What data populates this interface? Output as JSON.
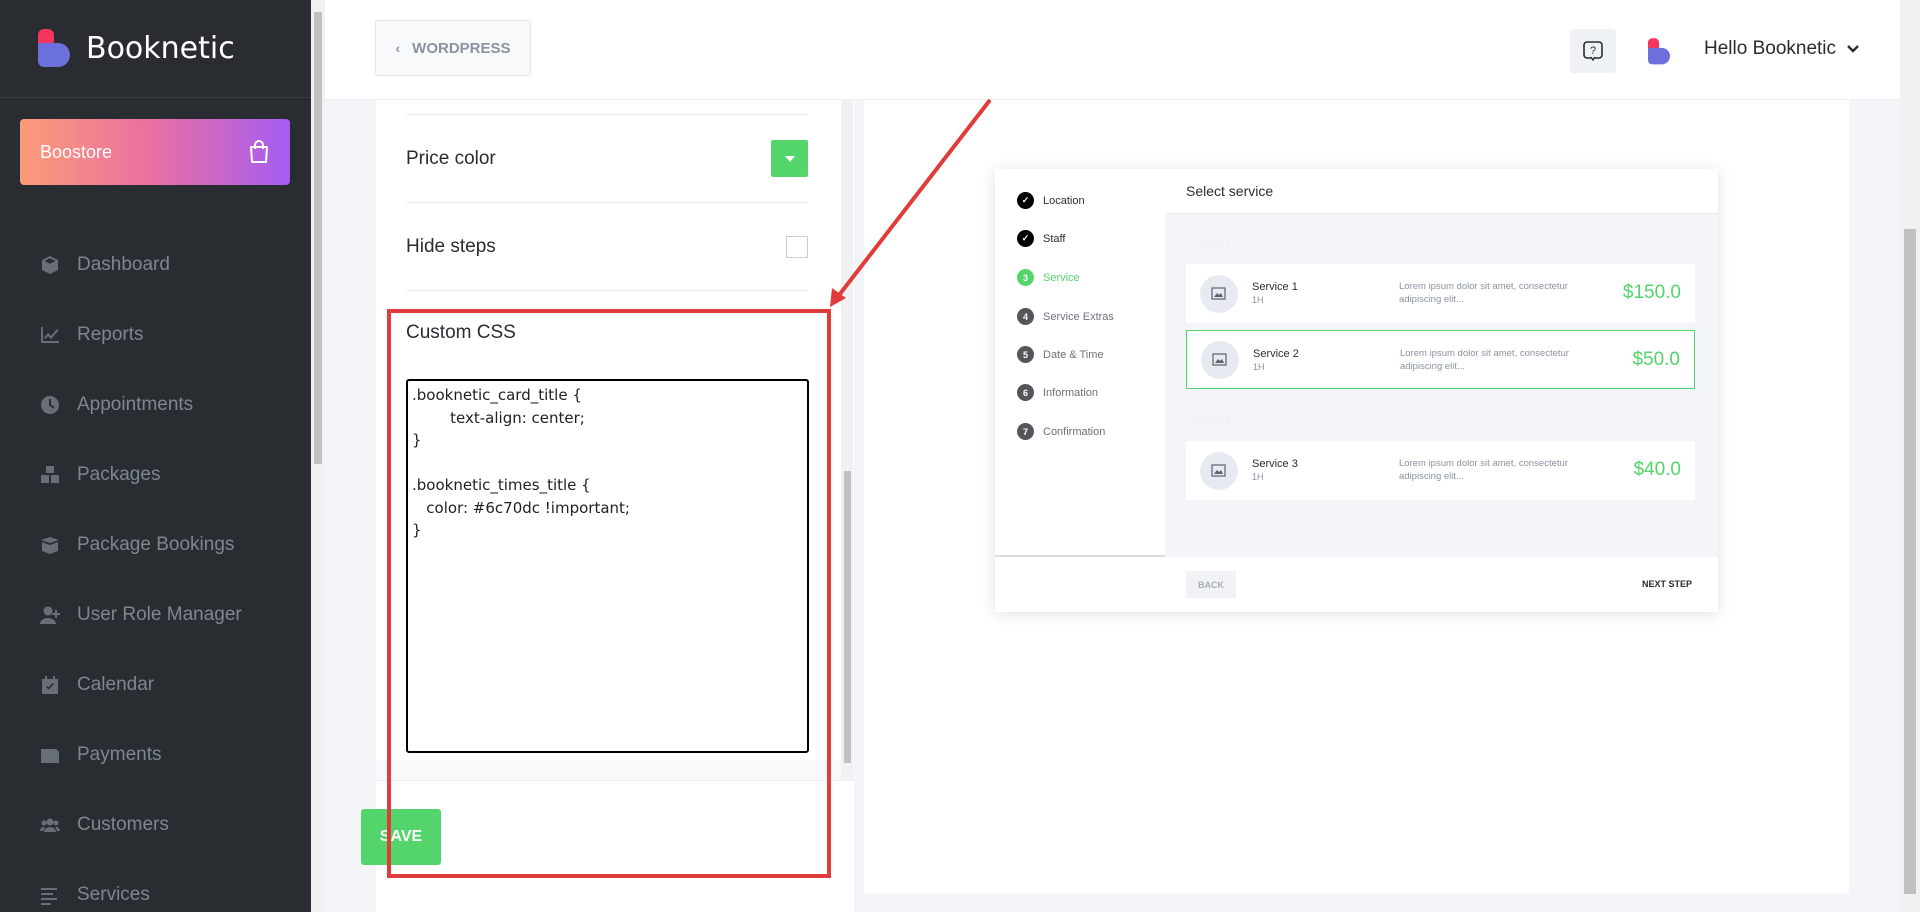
{
  "brand": {
    "name": "Booknetic"
  },
  "boostore": {
    "label": "Boostore"
  },
  "sidebar": {
    "items": [
      {
        "label": "Dashboard",
        "icon": "cube-icon"
      },
      {
        "label": "Reports",
        "icon": "chart-line-icon"
      },
      {
        "label": "Appointments",
        "icon": "clock-icon"
      },
      {
        "label": "Packages",
        "icon": "boxes-icon"
      },
      {
        "label": "Package Bookings",
        "icon": "box-open-icon"
      },
      {
        "label": "User Role Manager",
        "icon": "user-plus-icon"
      },
      {
        "label": "Calendar",
        "icon": "calendar-check-icon"
      },
      {
        "label": "Payments",
        "icon": "wallet-icon"
      },
      {
        "label": "Customers",
        "icon": "users-icon"
      },
      {
        "label": "Services",
        "icon": "list-icon"
      }
    ]
  },
  "header": {
    "wordpress_label": "WORDPRESS",
    "user_greeting": "Hello Booknetic"
  },
  "settings": {
    "price_color_label": "Price color",
    "hide_steps_label": "Hide steps",
    "custom_css_label": "Custom CSS",
    "custom_css_value": ".booknetic_card_title {\n\ttext-align: center;\n}\n\n.booknetic_times_title {\n   color: #6c70dc !important;\n}",
    "save_label": "SAVE",
    "accent_color": "#53d56c"
  },
  "preview": {
    "steps": [
      {
        "num": "1",
        "label": "Location",
        "state": "done"
      },
      {
        "num": "2",
        "label": "Staff",
        "state": "done"
      },
      {
        "num": "3",
        "label": "Service",
        "state": "active"
      },
      {
        "num": "4",
        "label": "Service Extras",
        "state": "pending"
      },
      {
        "num": "5",
        "label": "Date & Time",
        "state": "pending"
      },
      {
        "num": "6",
        "label": "Information",
        "state": "pending"
      },
      {
        "num": "7",
        "label": "Confirmation",
        "state": "pending"
      }
    ],
    "title": "Select service",
    "categories": [
      "Category 1",
      "Category 2"
    ],
    "services": [
      {
        "name": "Service 1",
        "duration": "1H",
        "desc": "Lorem ipsum dolor sit amet, consectetur adipiscing elit...",
        "price": "$150.0"
      },
      {
        "name": "Service 2",
        "duration": "1H",
        "desc": "Lorem ipsum dolor sit amet, consectetur adipiscing elit...",
        "price": "$50.0"
      },
      {
        "name": "Service 3",
        "duration": "1H",
        "desc": "Lorem ipsum dolor sit amet, consectetur adipiscing elit...",
        "price": "$40.0"
      }
    ],
    "back_label": "BACK",
    "next_label": "NEXT STEP"
  },
  "annotation": {
    "color": "#e13b3b"
  }
}
